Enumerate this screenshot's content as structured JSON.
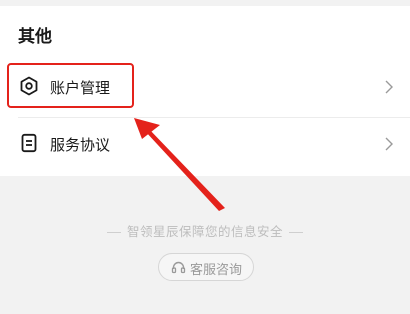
{
  "section": {
    "title": "其他"
  },
  "rows": [
    {
      "label": "账户管理",
      "icon": "hexagon-settings-icon"
    },
    {
      "label": "服务协议",
      "icon": "document-icon"
    }
  ],
  "footer": {
    "security_text": "智领星辰保障您的信息安全",
    "service_label": "客服咨询",
    "service_icon": "headset-icon"
  },
  "annotation": {
    "color": "#e4221b"
  }
}
